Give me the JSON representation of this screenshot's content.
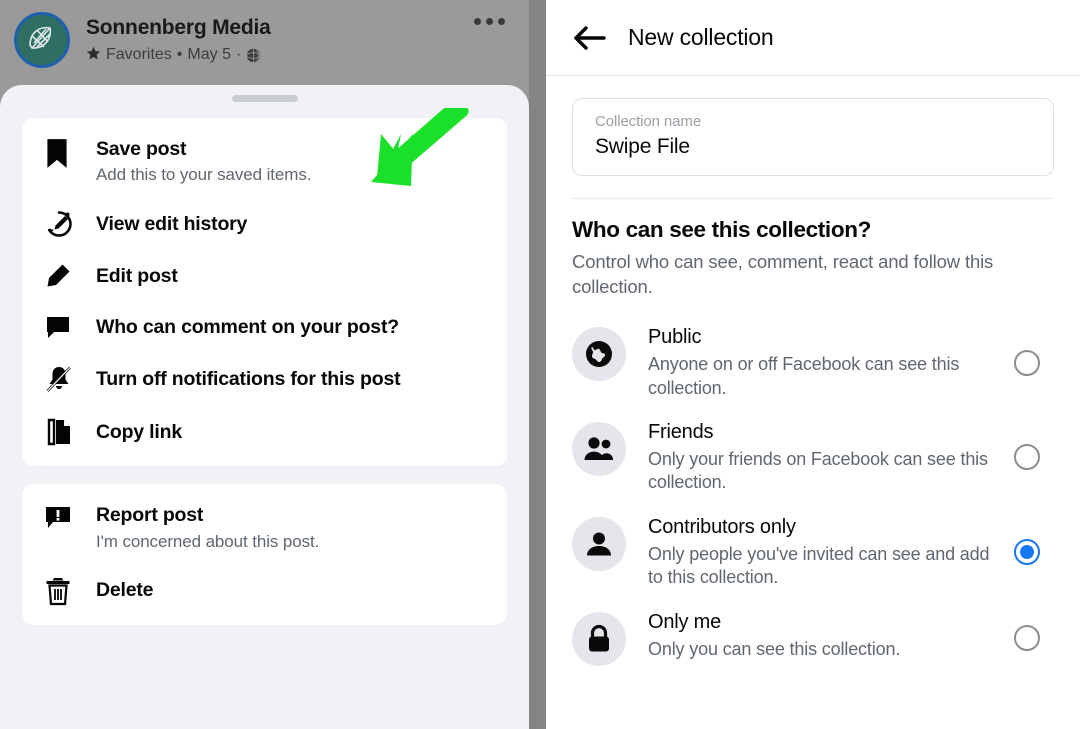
{
  "left_panel": {
    "post": {
      "author": "Sonnenberg Media",
      "audience_label": "Favorites",
      "separator": "•",
      "date": "May 5",
      "privacy_icon": "globe-icon",
      "star_icon": "star-icon",
      "more_button": "more-options-icon",
      "avatar_alt": "Sonnenberg Media logo"
    },
    "menu_groups": [
      {
        "items": [
          {
            "icon": "bookmark-icon",
            "title": "Save post",
            "subtitle": "Add this to your saved items."
          },
          {
            "icon": "edit-history-icon",
            "title": "View edit history",
            "subtitle": ""
          },
          {
            "icon": "pencil-icon",
            "title": "Edit post",
            "subtitle": ""
          },
          {
            "icon": "comment-bubble-icon",
            "title": "Who can comment on your post?",
            "subtitle": ""
          },
          {
            "icon": "bell-off-icon",
            "title": "Turn off notifications for this post",
            "subtitle": ""
          },
          {
            "icon": "copy-link-icon",
            "title": "Copy link",
            "subtitle": ""
          }
        ]
      },
      {
        "items": [
          {
            "icon": "report-icon",
            "title": "Report post",
            "subtitle": "I'm concerned about this post."
          },
          {
            "icon": "trash-icon",
            "title": "Delete",
            "subtitle": ""
          }
        ]
      }
    ],
    "annotation": {
      "type": "arrow",
      "color": "#1BE02A",
      "points_to": "Save post"
    }
  },
  "right_panel": {
    "header": {
      "back_icon": "back-arrow-icon",
      "title": "New collection"
    },
    "name_field": {
      "label": "Collection name",
      "value": "Swipe File",
      "placeholder": "Collection name"
    },
    "privacy": {
      "heading": "Who can see this collection?",
      "description": "Control who can see, comment, react and follow this collection.",
      "selected": "Contributors only",
      "accent_color": "#1877F2",
      "options": [
        {
          "icon": "globe-icon",
          "title": "Public",
          "description": "Anyone on or off Facebook can see this collection.",
          "selected": false
        },
        {
          "icon": "friends-icon",
          "title": "Friends",
          "description": "Only your friends on Facebook can see this collection.",
          "selected": false
        },
        {
          "icon": "person-icon",
          "title": "Contributors only",
          "description": "Only people you've invited can see and add to this collection.",
          "selected": true
        },
        {
          "icon": "lock-icon",
          "title": "Only me",
          "description": "Only you can see this collection.",
          "selected": false
        }
      ]
    }
  }
}
